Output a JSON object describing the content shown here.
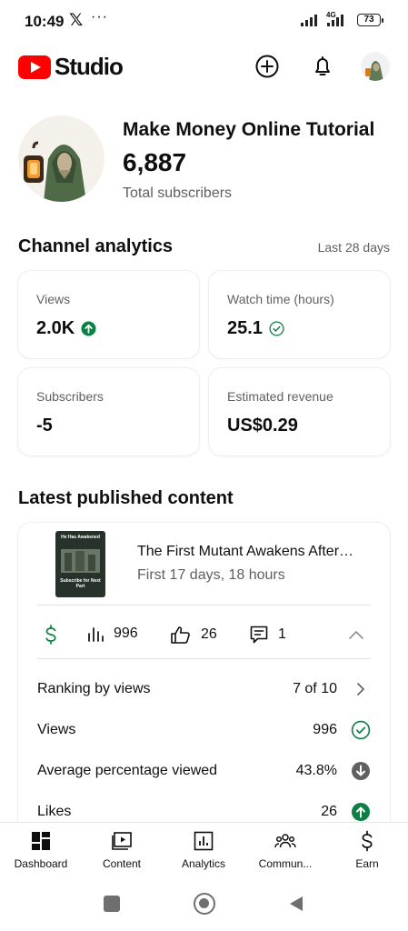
{
  "status_bar": {
    "time": "10:49",
    "x_glyph": "𝕏",
    "more": "···",
    "network": "4G",
    "battery": "73"
  },
  "header": {
    "brand": "Studio",
    "create_icon": "plus-circle-icon",
    "notifications_icon": "bell-icon",
    "brand_color": "#ff0000"
  },
  "channel": {
    "name": "Make Money Online Tutorial",
    "subscribers": "6,887",
    "subscribers_label": "Total subscribers"
  },
  "analytics": {
    "title": "Channel analytics",
    "range": "Last 28 days",
    "cards": [
      {
        "label": "Views",
        "value": "2.0K",
        "indicator": "up-arrow-circle-icon"
      },
      {
        "label": "Watch time (hours)",
        "value": "25.1",
        "indicator": "check-circle-icon"
      },
      {
        "label": "Subscribers",
        "value": "-5"
      },
      {
        "label": "Estimated revenue",
        "value": "US$0.29"
      }
    ]
  },
  "latest": {
    "title": "Latest published content",
    "video": {
      "title": "The First Mutant Awakens After…",
      "subtitle": "First 17 days, 18 hours",
      "thumb_top": "He Has Awakened",
      "thumb_bottom": "Subscribe for Next Part"
    },
    "stats": {
      "views": "996",
      "likes": "26",
      "comments": "1"
    },
    "metrics": [
      {
        "label": "Ranking by views",
        "value": "7 of 10",
        "icon": "chevron-right-icon"
      },
      {
        "label": "Views",
        "value": "996",
        "icon": "check-circle-icon"
      },
      {
        "label": "Average percentage viewed",
        "value": "43.8%",
        "icon": "down-arrow-circle-icon"
      },
      {
        "label": "Likes",
        "value": "26",
        "icon": "up-arrow-circle-icon"
      }
    ]
  },
  "bottom_nav": [
    {
      "label": "Dashboard"
    },
    {
      "label": "Content"
    },
    {
      "label": "Analytics"
    },
    {
      "label": "Commun..."
    },
    {
      "label": "Earn"
    }
  ],
  "colors": {
    "positive": "#0b8043",
    "neutral_icon": "#606060"
  }
}
